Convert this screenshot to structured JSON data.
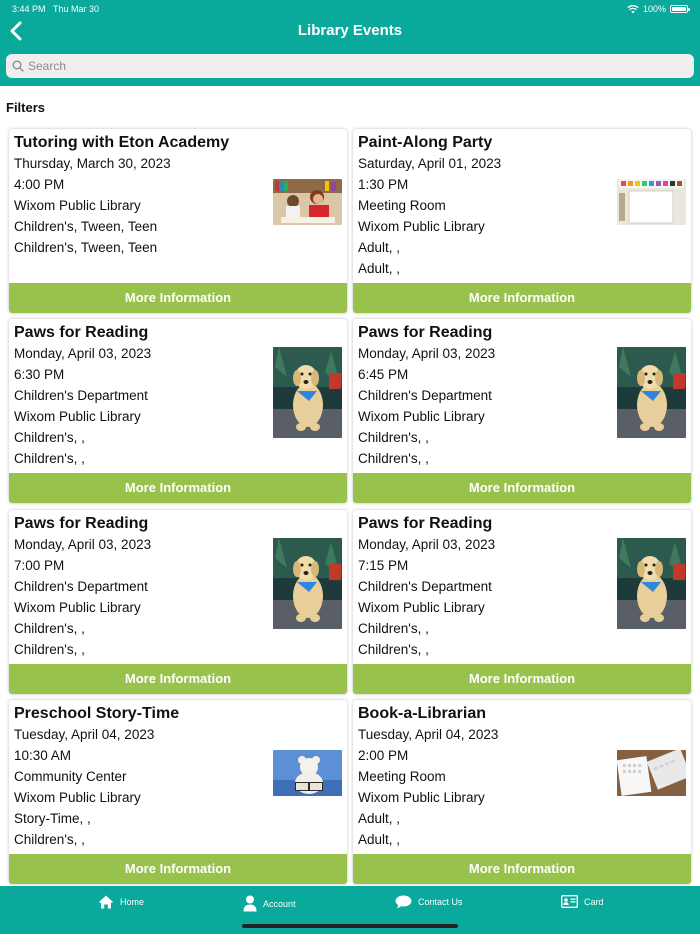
{
  "status": {
    "time": "3:44 PM",
    "date": "Thu Mar 30",
    "battery": "100%"
  },
  "nav": {
    "title": "Library Events"
  },
  "search": {
    "placeholder": "Search"
  },
  "filters_label": "Filters",
  "events": [
    {
      "title": "Tutoring with Eton Academy",
      "date": "Thursday, March 30, 2023",
      "time": "4:00 PM",
      "line3": "Wixom Public Library",
      "line4": "Children's, Tween, Teen",
      "line5": "Children's, Tween, Teen",
      "line6": "",
      "button": "More Information",
      "image": "tutoring-photo"
    },
    {
      "title": "Paint-Along Party",
      "date": "Saturday, April 01, 2023",
      "time": "1:30 PM",
      "line3": "Meeting Room",
      "line4": "Wixom Public Library",
      "line5": "Adult, ,",
      "line6": "Adult, ,",
      "button": "More Information",
      "image": "paint-palette-photo"
    },
    {
      "title": "Paws for Reading",
      "date": "Monday, April 03, 2023",
      "time": "6:30 PM",
      "line3": "Children's Department",
      "line4": "Wixom Public Library",
      "line5": "Children's, ,",
      "line6": "Children's, ,",
      "button": "More Information",
      "image": "dog-photo"
    },
    {
      "title": "Paws for Reading",
      "date": "Monday, April 03, 2023",
      "time": "6:45 PM",
      "line3": "Children's Department",
      "line4": "Wixom Public Library",
      "line5": "Children's, ,",
      "line6": "Children's, ,",
      "button": "More Information",
      "image": "dog-photo"
    },
    {
      "title": "Paws for Reading",
      "date": "Monday, April 03, 2023",
      "time": "7:00 PM",
      "line3": "Children's Department",
      "line4": "Wixom Public Library",
      "line5": "Children's, ,",
      "line6": "Children's, ,",
      "button": "More Information",
      "image": "dog-photo"
    },
    {
      "title": "Paws for Reading",
      "date": "Monday, April 03, 2023",
      "time": "7:15 PM",
      "line3": "Children's Department",
      "line4": "Wixom Public Library",
      "line5": "Children's, ,",
      "line6": "Children's, ,",
      "button": "More Information",
      "image": "dog-photo"
    },
    {
      "title": "Preschool Story-Time",
      "date": "Tuesday, April 04, 2023",
      "time": "10:30 AM",
      "line3": "Community Center",
      "line4": "Wixom Public Library",
      "line5": "Story-Time, ,",
      "line6": "Children's, ,",
      "button": "More Information",
      "image": "teddy-bear-photo"
    },
    {
      "title": "Book-a-Librarian",
      "date": "Tuesday, April 04, 2023",
      "time": "2:00 PM",
      "line3": "Meeting Room",
      "line4": "Wixom Public Library",
      "line5": "Adult, ,",
      "line6": "Adult, ,",
      "button": "More Information",
      "image": "keyboard-calendar-photo"
    }
  ],
  "tabs": [
    {
      "label": "Home",
      "icon": "home-icon"
    },
    {
      "label": "Account",
      "icon": "person-icon"
    },
    {
      "label": "Contact Us",
      "icon": "chat-bubble-icon"
    },
    {
      "label": "Card",
      "icon": "id-card-icon"
    }
  ],
  "colors": {
    "teal": "#09a99b",
    "green": "#99c24d"
  }
}
